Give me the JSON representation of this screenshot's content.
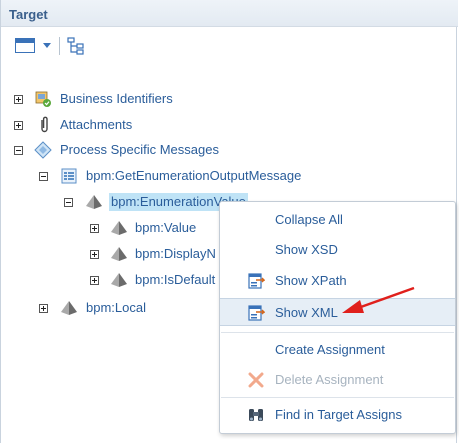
{
  "panel": {
    "title": "Target"
  },
  "toolbar": {
    "view_icon": "window-icon",
    "dropdown_icon": "caret-down-icon",
    "tree_icon": "tree-structure-icon"
  },
  "tree": {
    "business_identifiers": "Business Identifiers",
    "attachments": "Attachments",
    "process_specific_messages": "Process Specific Messages",
    "get_enum_output_message": "bpm:GetEnumerationOutputMessage",
    "enumeration_value": "bpm:EnumerationValue",
    "value": "bpm:Value",
    "display_name": "bpm:DisplayN",
    "is_default": "bpm:IsDefault",
    "local": "bpm:Local"
  },
  "context_menu": {
    "collapse_all": "Collapse All",
    "show_xsd": "Show XSD",
    "show_xpath": "Show XPath",
    "show_xml": "Show XML",
    "create_assignment": "Create Assignment",
    "delete_assignment": "Delete Assignment",
    "find_in_target_assigns": "Find in Target Assigns"
  },
  "colors": {
    "link_text": "#2a5d9a",
    "selection": "#bfe3f6",
    "menu_hover": "#e6eef6",
    "annotation_arrow": "#e0201c",
    "disabled_text": "#a7b3bf"
  }
}
